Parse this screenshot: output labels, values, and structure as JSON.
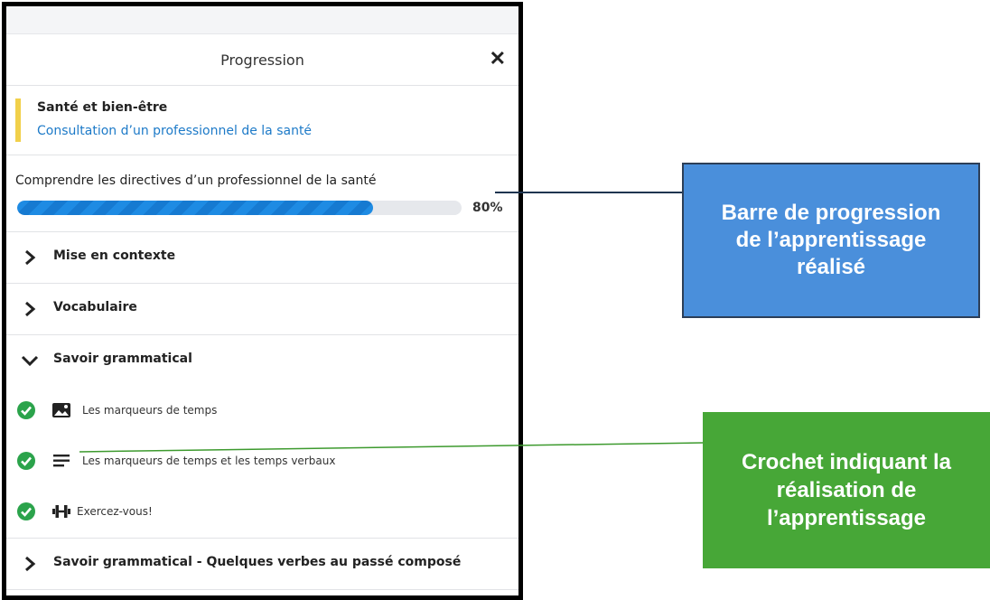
{
  "panel": {
    "title": "Progression",
    "close_icon": "close-icon",
    "topic": {
      "category": "Santé et bien-être",
      "subcategory": "Consultation d’un professionnel de la santé",
      "accent_color": "#f1d04a"
    },
    "lesson": {
      "title": "Comprendre les directives d’un professionnel de la santé",
      "progress_value": 0.8,
      "progress_label": "80%"
    },
    "sections": [
      {
        "label": "Mise en contexte",
        "state": "collapsed",
        "icon": "chevron-right-icon"
      },
      {
        "label": "Vocabulaire",
        "state": "collapsed",
        "icon": "chevron-right-icon"
      },
      {
        "label": "Savoir grammatical",
        "state": "expanded",
        "icon": "chevron-down-icon"
      }
    ],
    "subitems": [
      {
        "label": "Les marqueurs de temps",
        "icon": "image-icon",
        "completed": true
      },
      {
        "label": "Les marqueurs de temps et les temps verbaux",
        "icon": "text-lines-icon",
        "completed": true
      },
      {
        "label": "Exercez-vous!",
        "icon": "dumbbell-icon",
        "completed": true
      }
    ],
    "last_section": {
      "label": "Savoir grammatical - Quelques verbes au passé composé",
      "state": "collapsed",
      "icon": "chevron-right-icon"
    }
  },
  "callouts": {
    "progress_bar": "Barre de progression de l’apprentissage réalisé",
    "checkmark": "Crochet indiquant la réalisation de l’apprentissage"
  },
  "colors": {
    "progress_fill": "#1e8be3",
    "check_green": "#2ba34b",
    "callout_blue": "#4a8fdb",
    "callout_green": "#47a737",
    "link_blue": "#1d7ac8"
  }
}
